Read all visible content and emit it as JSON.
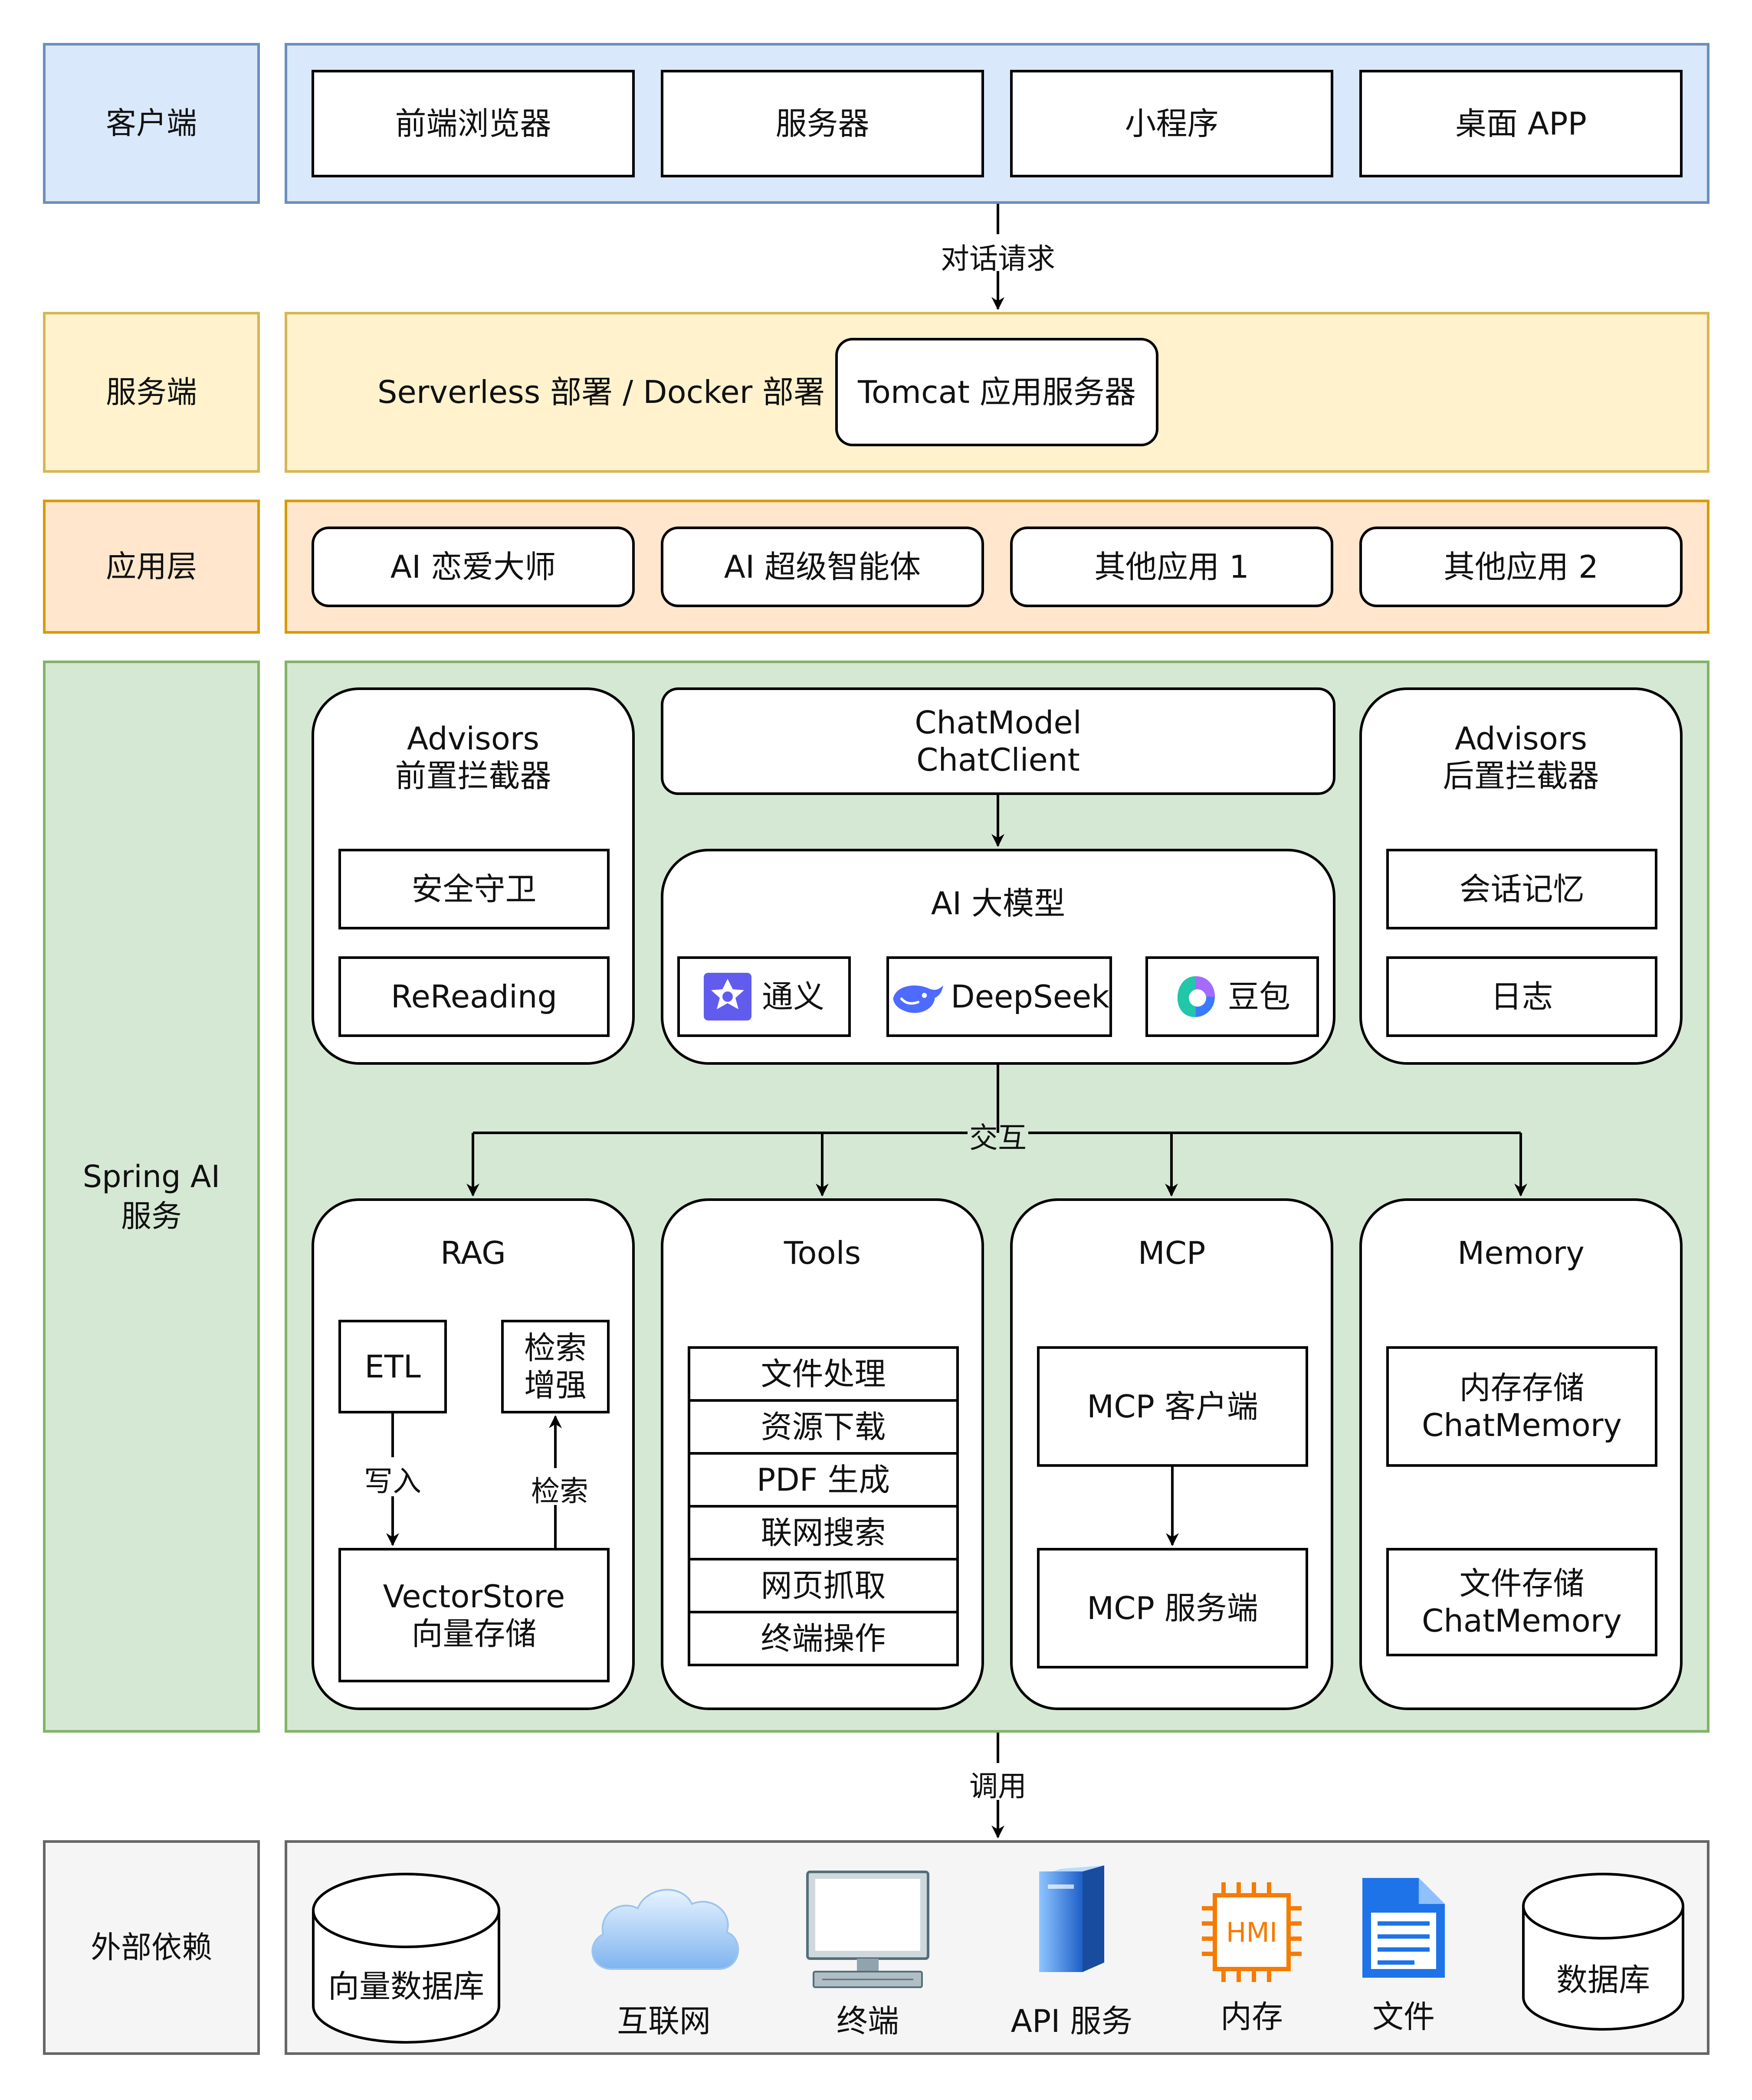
{
  "layers": {
    "client": "客户端",
    "server": "服务端",
    "app": "应用层",
    "spring": [
      "Spring AI",
      "服务"
    ],
    "external": "外部依赖"
  },
  "client_items": [
    "前端浏览器",
    "服务器",
    "小程序",
    "桌面 APP"
  ],
  "edge_labels": {
    "request": "对话请求",
    "interact": "交互",
    "invoke": "调用",
    "write": "写入",
    "retrieve": "检索"
  },
  "server_row": {
    "deploy": "Serverless 部署 / Docker 部署",
    "tomcat": "Tomcat 应用服务器"
  },
  "app_items": [
    "AI 恋爱大师",
    "AI 超级智能体",
    "其他应用 1",
    "其他应用 2"
  ],
  "advisors_pre": {
    "title": [
      "Advisors",
      "前置拦截器"
    ],
    "items": [
      "安全守卫",
      "ReReading"
    ]
  },
  "chat": [
    "ChatModel",
    "ChatClient"
  ],
  "llm": {
    "title": "AI 大模型",
    "models": [
      "通义",
      "DeepSeek",
      "豆包"
    ]
  },
  "advisors_post": {
    "title": [
      "Advisors",
      "后置拦截器"
    ],
    "items": [
      "会话记忆",
      "日志"
    ]
  },
  "rag": {
    "title": "RAG",
    "etl": "ETL",
    "aug": [
      "检索",
      "增强"
    ],
    "store": [
      "VectorStore",
      "向量存储"
    ]
  },
  "tools": {
    "title": "Tools",
    "items": [
      "文件处理",
      "资源下载",
      "PDF 生成",
      "联网搜索",
      "网页抓取",
      "终端操作"
    ]
  },
  "mcp": {
    "title": "MCP",
    "client": "MCP 客户端",
    "server": "MCP 服务端"
  },
  "memory": {
    "title": "Memory",
    "mem": [
      "内存存储",
      "ChatMemory"
    ],
    "file": [
      "文件存储",
      "ChatMemory"
    ]
  },
  "external_items": [
    "向量数据库",
    "互联网",
    "终端",
    "API 服务",
    "内存",
    "文件",
    "数据库"
  ],
  "icons": {
    "hmi": "HMI",
    "colors": {
      "tongyi": "#615ced",
      "deepseek": "#4d6bfe",
      "doubao": "#3a7bfd",
      "cloud": "#7fb4ef",
      "server": "#2f6fd6",
      "chip": "#f57c00",
      "file": "#1e73e8"
    }
  }
}
